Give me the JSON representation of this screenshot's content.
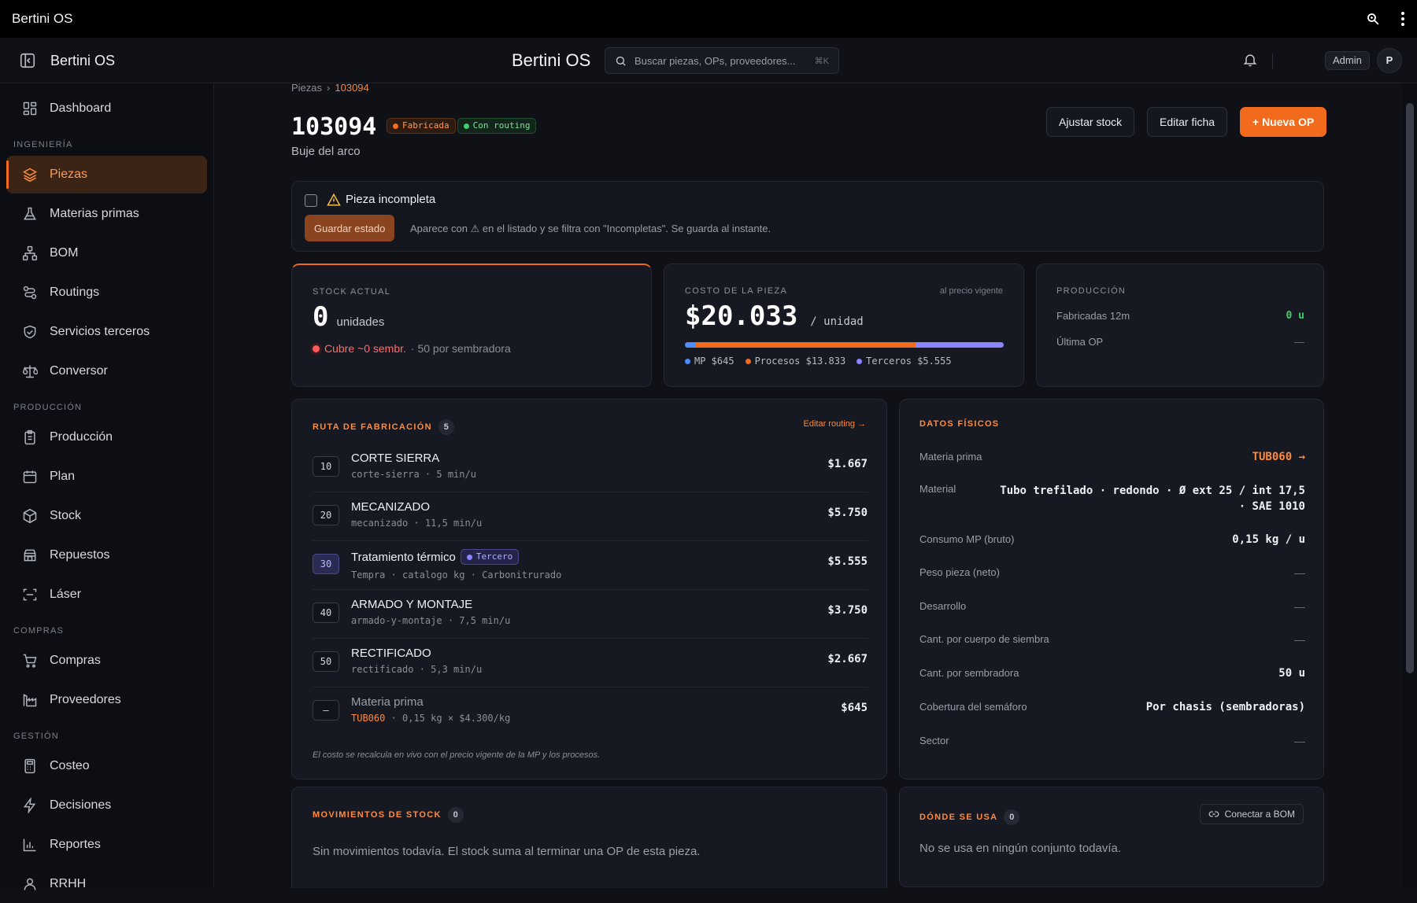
{
  "window": {
    "title": "Bertini OS"
  },
  "header": {
    "brand_left": "Bertini OS",
    "brand_center": "Bertini OS",
    "search_placeholder": "Buscar piezas, OPs, proveedores...",
    "search_shortcut": "⌘K",
    "user_role": "Admin",
    "avatar_initial": "P"
  },
  "sidebar": {
    "top": [
      {
        "label": "Dashboard",
        "icon": "grid-icon"
      }
    ],
    "sections": [
      {
        "title": "INGENIERÍA",
        "items": [
          {
            "label": "Piezas",
            "icon": "layers-icon",
            "active": true
          },
          {
            "label": "Materias primas",
            "icon": "flask-icon"
          },
          {
            "label": "BOM",
            "icon": "hierarchy-icon"
          },
          {
            "label": "Routings",
            "icon": "route-icon"
          },
          {
            "label": "Servicios terceros",
            "icon": "handshake-icon"
          },
          {
            "label": "Conversor",
            "icon": "scale-icon"
          }
        ]
      },
      {
        "title": "PRODUCCIÓN",
        "items": [
          {
            "label": "Producción",
            "icon": "clipboard-icon"
          },
          {
            "label": "Plan",
            "icon": "calendar-icon"
          },
          {
            "label": "Stock",
            "icon": "box-icon"
          },
          {
            "label": "Repuestos",
            "icon": "store-icon"
          },
          {
            "label": "Láser",
            "icon": "scan-icon"
          }
        ]
      },
      {
        "title": "COMPRAS",
        "items": [
          {
            "label": "Compras",
            "icon": "cart-icon"
          },
          {
            "label": "Proveedores",
            "icon": "factory-icon"
          }
        ]
      },
      {
        "title": "GESTIÓN",
        "items": [
          {
            "label": "Costeo",
            "icon": "calculator-icon"
          },
          {
            "label": "Decisiones",
            "icon": "bolt-icon"
          },
          {
            "label": "Reportes",
            "icon": "bar-chart-icon"
          },
          {
            "label": "RRHH",
            "icon": "user-icon"
          }
        ]
      }
    ]
  },
  "page": {
    "breadcrumb": [
      "Piezas",
      "›",
      "103094"
    ],
    "title": "103094",
    "subtitle": "Buje del arco",
    "tags": [
      "Fabricada",
      "Con routing"
    ],
    "buttons": {
      "adjust": "Ajustar stock",
      "edit": "Editar ficha",
      "new_op": "+ Nueva OP"
    }
  },
  "incomplete": {
    "title": "Pieza incompleta",
    "save_label": "Guardar estado",
    "help": "Aparece con ⚠ en el listado y se filtra con \"Incompletas\". Se guarda al instante."
  },
  "stock": {
    "label": "STOCK ACTUAL",
    "value": "0",
    "unit": "unidades",
    "coverage": "Cubre ~0 sembr.",
    "per": "· 50 por sembradora"
  },
  "cost": {
    "label": "COSTO DE LA PIEZA",
    "note": "al precio vigente",
    "value": "$20.033",
    "unit": "/ unidad",
    "legend": [
      {
        "name": "MP",
        "value": "$645",
        "color": "#4f8cff",
        "fraction": 0.032
      },
      {
        "name": "Procesos",
        "value": "$13.833",
        "color": "#f26a1b",
        "fraction": 0.691
      },
      {
        "name": "Terceros",
        "value": "$5.555",
        "color": "#8b86ff",
        "fraction": 0.277
      }
    ]
  },
  "production": {
    "label": "PRODUCCIÓN",
    "rows": [
      {
        "k": "Fabricadas 12m",
        "v": "0 u"
      },
      {
        "k": "Última OP",
        "v": "—"
      }
    ]
  },
  "routing": {
    "label": "RUTA DE FABRICACIÓN",
    "count": "5",
    "edit_link": "Editar routing →",
    "third_party_tag": "Tercero",
    "ops": [
      {
        "num": "10",
        "name": "CORTE SIERRA",
        "sub": "corte-sierra · 5 min/u",
        "cost": "$1.667"
      },
      {
        "num": "20",
        "name": "MECANIZADO",
        "sub": "mecanizado · 11,5 min/u",
        "cost": "$5.750"
      },
      {
        "num": "30",
        "name": "Tratamiento térmico",
        "sub": "Tempra · catalogo kg · Carbonitrurado",
        "cost": "$5.555",
        "external": true
      },
      {
        "num": "40",
        "name": "ARMADO Y MONTAJE",
        "sub": "armado-y-montaje · 7,5 min/u",
        "cost": "$3.750"
      },
      {
        "num": "50",
        "name": "RECTIFICADO",
        "sub": "rectificado · 5,3 min/u",
        "cost": "$2.667"
      }
    ],
    "material": {
      "num": "—",
      "name": "Materia prima",
      "code": "TUB060",
      "sub": "· 0,15 kg × $4.300/kg",
      "cost": "$645"
    },
    "footnote": "El costo se recalcula en vivo con el precio vigente de la MP y los procesos."
  },
  "physical": {
    "label": "DATOS FÍSICOS",
    "rows": [
      {
        "k": "Materia prima",
        "v": "TUB060 →",
        "style": "or"
      },
      {
        "k": "Material",
        "v": "Tubo trefilado · redondo · Ø ext 25 / int 17,5 · SAE 1010",
        "style": ""
      },
      {
        "k": "Consumo MP (bruto)",
        "v": "0,15 kg / u",
        "style": ""
      },
      {
        "k": "Peso pieza (neto)",
        "v": "—",
        "style": "dash"
      },
      {
        "k": "Desarrollo",
        "v": "—",
        "style": "dash"
      },
      {
        "k": "Cant. por cuerpo de siembra",
        "v": "—",
        "style": "dash"
      },
      {
        "k": "Cant. por sembradora",
        "v": "50 u",
        "style": ""
      },
      {
        "k": "Cobertura del semáforo",
        "v": "Por chasis (sembradoras)",
        "style": ""
      },
      {
        "k": "Sector",
        "v": "—",
        "style": "dash"
      }
    ]
  },
  "movements": {
    "label": "MOVIMIENTOS DE STOCK",
    "count": "0",
    "empty": "Sin movimientos todavía. El stock suma al terminar una OP de esta pieza."
  },
  "usage": {
    "label": "DÓNDE SE USA",
    "count": "0",
    "connect": "Conectar a BOM",
    "empty": "No se usa en ningún conjunto todavía."
  },
  "colors": {
    "accent": "#f26a1b",
    "green": "#3fcf6a",
    "purple": "#8b86ff",
    "blue": "#4f8cff",
    "red": "#ff5a5a"
  }
}
